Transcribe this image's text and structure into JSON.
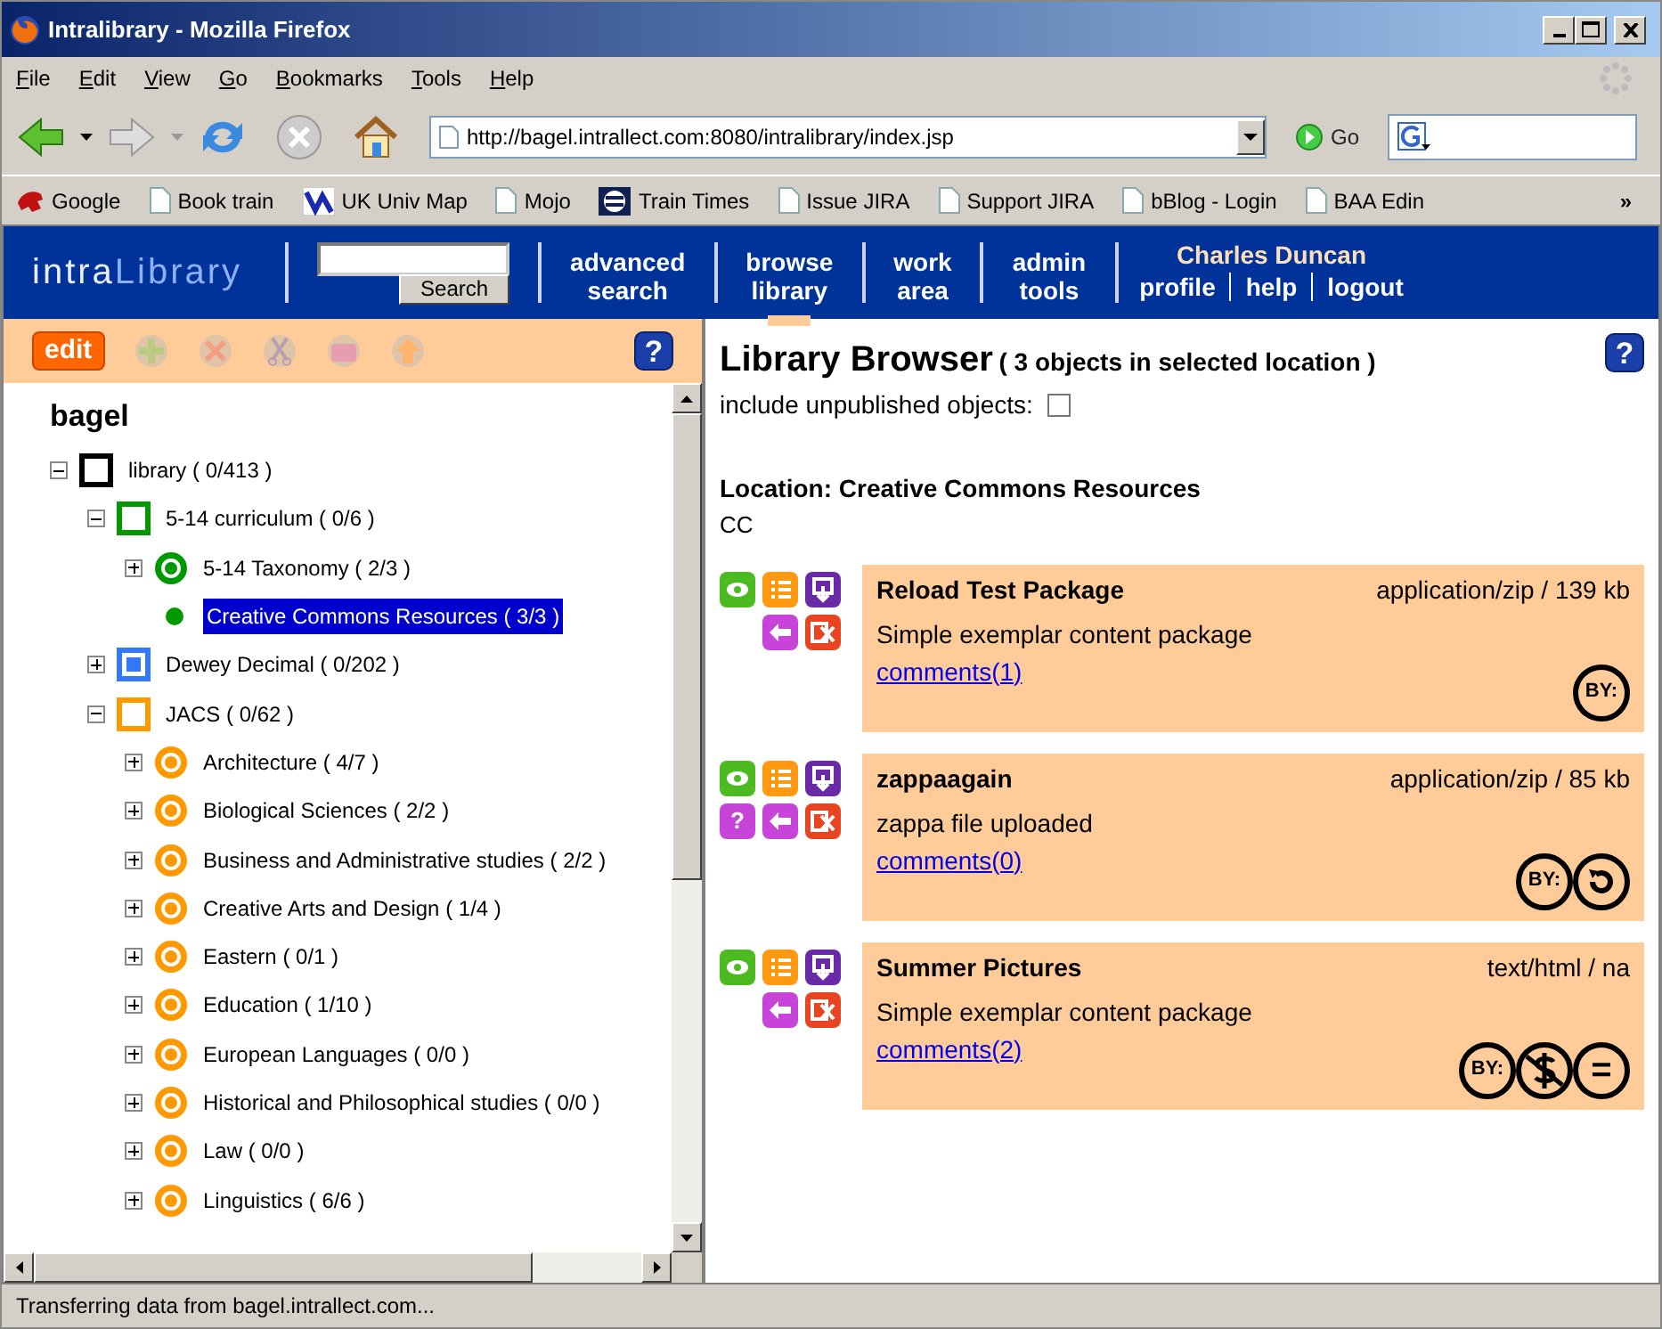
{
  "window": {
    "title": "Intralibrary - Mozilla Firefox"
  },
  "menu": [
    "File",
    "Edit",
    "View",
    "Go",
    "Bookmarks",
    "Tools",
    "Help"
  ],
  "navigation": {
    "url": "http://bagel.intrallect.com:8080/intralibrary/index.jsp",
    "go": "Go"
  },
  "bookmarks": [
    {
      "label": "Google",
      "kind": "bird"
    },
    {
      "label": "Book train",
      "kind": "page"
    },
    {
      "label": "UK Univ Map",
      "kind": "map"
    },
    {
      "label": "Mojo",
      "kind": "page"
    },
    {
      "label": "Train Times",
      "kind": "emblem"
    },
    {
      "label": "Issue JIRA",
      "kind": "page"
    },
    {
      "label": "Support JIRA",
      "kind": "page"
    },
    {
      "label": "bBlog - Login",
      "kind": "page"
    },
    {
      "label": "BAA Edin",
      "kind": "page"
    }
  ],
  "bookmarks_overflow": "»",
  "header": {
    "logo": {
      "first": "intra",
      "second": "Library"
    },
    "search_button": "Search",
    "nav": [
      {
        "lines": [
          "advanced",
          "search"
        ],
        "selected": false
      },
      {
        "lines": [
          "browse",
          "library"
        ],
        "selected": true
      },
      {
        "lines": [
          "work",
          "area"
        ],
        "selected": false
      },
      {
        "lines": [
          "admin",
          "tools"
        ],
        "selected": false
      }
    ],
    "user": "Charles Duncan",
    "links": [
      "profile",
      "help",
      "logout"
    ]
  },
  "left_panel": {
    "edit_button": "edit",
    "tools": [
      {
        "kind": "add",
        "disabled": true
      },
      {
        "kind": "remove",
        "disabled": true
      },
      {
        "kind": "cut",
        "disabled": true
      },
      {
        "kind": "folder",
        "disabled": true
      },
      {
        "kind": "up",
        "disabled": true
      }
    ],
    "help": "?",
    "tree": {
      "root": "bagel",
      "nodes": [
        {
          "label": "library ( 0/413 )",
          "kind": "square",
          "color": "#000000",
          "expanded": true,
          "selected": false,
          "children": [
            {
              "label": "5-14 curriculum ( 0/6 )",
              "kind": "square",
              "color": "#009900",
              "expanded": true,
              "selected": false,
              "children": [
                {
                  "label": "5-14 Taxonomy ( 2/3 )",
                  "kind": "ring",
                  "color": "#009900",
                  "expanded": false,
                  "selected": false
                },
                {
                  "label": "Creative Commons Resources ( 3/3 )",
                  "kind": "dot",
                  "color": "#009900",
                  "selected": true
                }
              ]
            },
            {
              "label": "Dewey Decimal ( 0/202 )",
              "kind": "square-filled",
              "color": "#3377ff",
              "expanded": false,
              "selected": false
            },
            {
              "label": "JACS ( 0/62 )",
              "kind": "square",
              "color": "#ff9900",
              "expanded": true,
              "selected": false,
              "children": [
                {
                  "label": "Architecture ( 4/7 )",
                  "kind": "ring",
                  "color": "#ff9900",
                  "expanded": false,
                  "selected": false
                },
                {
                  "label": "Biological Sciences ( 2/2 )",
                  "kind": "ring",
                  "color": "#ff9900",
                  "expanded": false,
                  "selected": false
                },
                {
                  "label": "Business and Administrative studies ( 2/2 )",
                  "kind": "ring",
                  "color": "#ff9900",
                  "expanded": false,
                  "selected": false
                },
                {
                  "label": "Creative Arts and Design ( 1/4 )",
                  "kind": "ring",
                  "color": "#ff9900",
                  "expanded": false,
                  "selected": false
                },
                {
                  "label": "Eastern ( 0/1 )",
                  "kind": "ring",
                  "color": "#ff9900",
                  "expanded": false,
                  "selected": false
                },
                {
                  "label": "Education ( 1/10 )",
                  "kind": "ring",
                  "color": "#ff9900",
                  "expanded": false,
                  "selected": false
                },
                {
                  "label": "European Languages ( 0/0 )",
                  "kind": "ring",
                  "color": "#ff9900",
                  "expanded": false,
                  "selected": false
                },
                {
                  "label": "Historical and Philosophical studies ( 0/0 )",
                  "kind": "ring",
                  "color": "#ff9900",
                  "expanded": false,
                  "selected": false
                },
                {
                  "label": "Law ( 0/0 )",
                  "kind": "ring",
                  "color": "#ff9900",
                  "expanded": false,
                  "selected": false
                },
                {
                  "label": "Linguistics ( 6/6 )",
                  "kind": "ring",
                  "color": "#ff9900",
                  "expanded": false,
                  "selected": false
                }
              ]
            }
          ]
        }
      ]
    }
  },
  "library_browser": {
    "title": "Library Browser",
    "summary": "( 3 objects in selected location )",
    "include_label": "include unpublished objects:",
    "include_checked": false,
    "help": "?",
    "location": "Location: Creative Commons Resources",
    "location_code": "CC",
    "items": [
      {
        "title": "Reload Test Package",
        "type": "application/zip / 139 kb",
        "description": "Simple exemplar content package",
        "comments": "comments(1)",
        "actions": [
          {
            "kind": "preview"
          },
          {
            "kind": "metadata"
          },
          {
            "kind": "download"
          },
          {
            "kind": "move"
          },
          {
            "kind": "delete"
          }
        ],
        "licences": [
          {
            "kind": "by",
            "symbol": "BY:"
          }
        ]
      },
      {
        "title": "zappaagain",
        "type": "application/zip / 85 kb",
        "description": "zappa file uploaded",
        "comments": "comments(0)",
        "actions": [
          {
            "kind": "preview"
          },
          {
            "kind": "metadata"
          },
          {
            "kind": "download"
          },
          {
            "kind": "help",
            "symbol": "?"
          },
          {
            "kind": "move"
          },
          {
            "kind": "delete"
          }
        ],
        "licences": [
          {
            "kind": "by",
            "symbol": "BY:"
          },
          {
            "kind": "sa"
          }
        ]
      },
      {
        "title": "Summer Pictures",
        "type": "text/html / na",
        "description": "Simple exemplar content package",
        "comments": "comments(2)",
        "actions": [
          {
            "kind": "preview"
          },
          {
            "kind": "metadata"
          },
          {
            "kind": "download"
          },
          {
            "kind": "move"
          },
          {
            "kind": "delete"
          }
        ],
        "licences": [
          {
            "kind": "by",
            "symbol": "BY:"
          },
          {
            "kind": "nc"
          },
          {
            "kind": "nd",
            "symbol": "="
          }
        ]
      }
    ]
  },
  "status_bar": "Transferring data from bagel.intrallect.com..."
}
